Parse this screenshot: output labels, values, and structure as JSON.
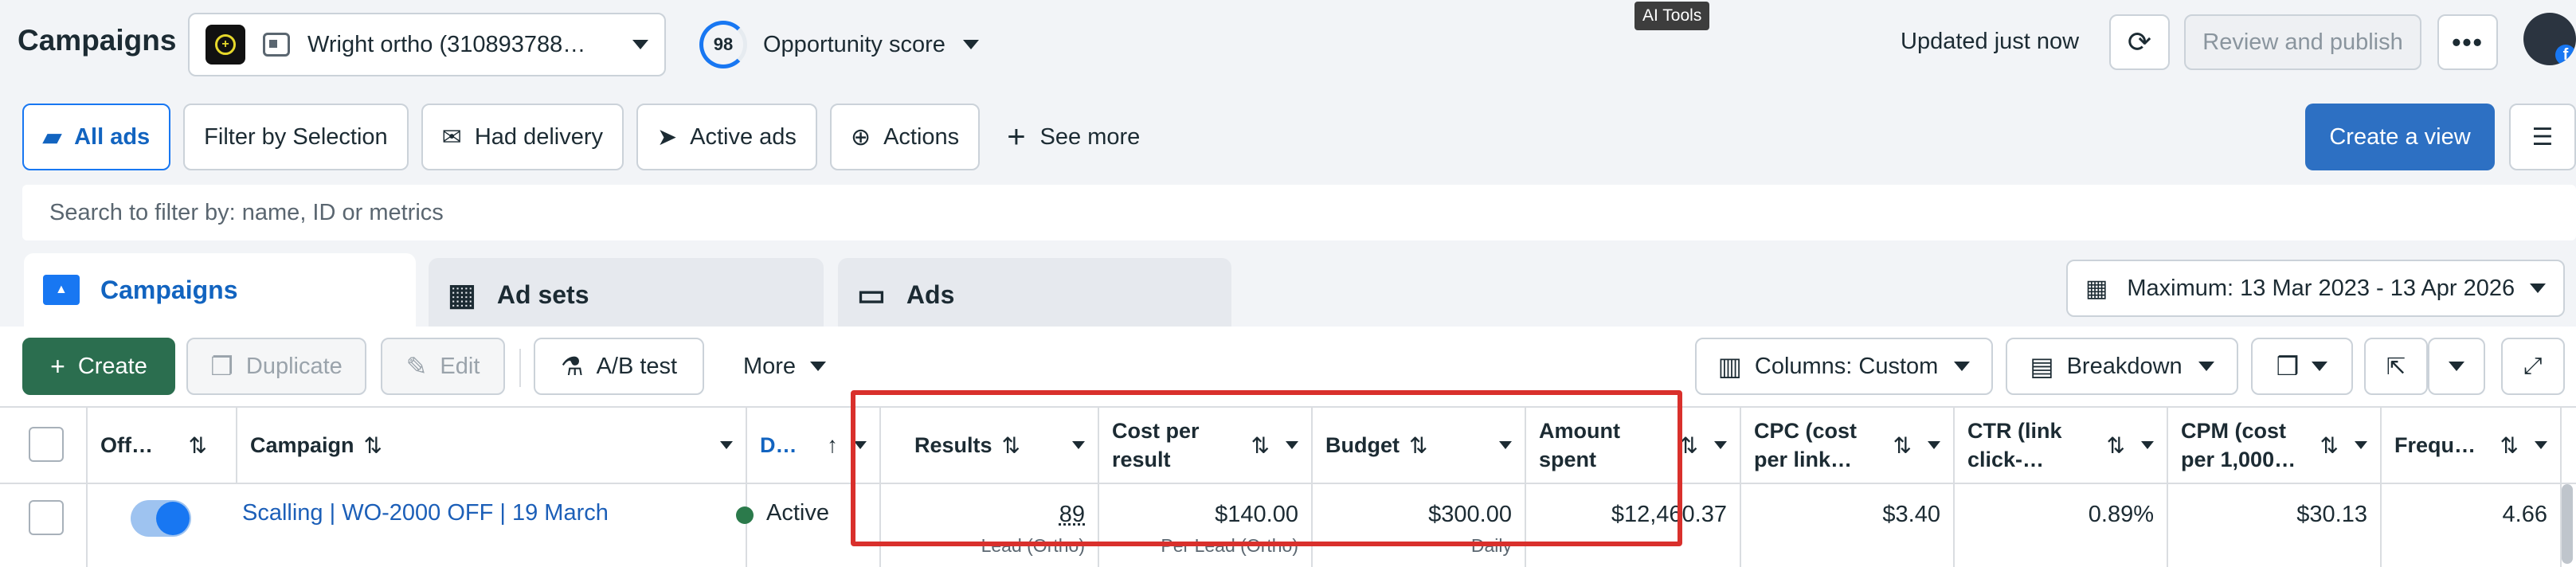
{
  "header": {
    "title": "Campaigns",
    "account_name": "Wright ortho (310893788…",
    "opportunity_score": "98",
    "opportunity_label": "Opportunity score",
    "tooltip": "AI Tools",
    "updated": "Updated just now",
    "review_label": "Review and publish",
    "more_label": "•••"
  },
  "filters": {
    "items": [
      {
        "label": "All ads",
        "icon": "folder-icon"
      },
      {
        "label": "Filter by Selection",
        "icon": ""
      },
      {
        "label": "Had delivery",
        "icon": "envelope-icon"
      },
      {
        "label": "Active ads",
        "icon": "send-icon"
      },
      {
        "label": "Actions",
        "icon": "upload-icon"
      }
    ],
    "see_more": "See more",
    "create_view": "Create a view"
  },
  "search": {
    "placeholder": "Search to filter by: name, ID or metrics"
  },
  "tabs": [
    {
      "label": "Campaigns"
    },
    {
      "label": "Ad sets"
    },
    {
      "label": "Ads"
    }
  ],
  "date_range": "Maximum: 13 Mar 2023 - 13 Apr 2026",
  "toolbar": {
    "create": "Create",
    "duplicate": "Duplicate",
    "edit": "Edit",
    "ab_test": "A/B test",
    "more": "More",
    "columns": "Columns: Custom",
    "breakdown": "Breakdown"
  },
  "table": {
    "headers": {
      "off_on": "Off…",
      "campaign": "Campaign",
      "delivery": "D…",
      "results": "Results",
      "cost_per_result": "Cost per result",
      "budget": "Budget",
      "amount_spent": "Amount spent",
      "cpc": "CPC (cost per link…",
      "ctr": "CTR (link click-…",
      "cpm": "CPM (cost per 1,000…",
      "frequency": "Frequ…"
    },
    "row": {
      "campaign": "Scalling | WO-2000 OFF | 19 March",
      "delivery": "Active",
      "results": "89",
      "results_sub": "Lead (Ortho)",
      "cost_per_result": "$140.00",
      "cost_per_result_sub": "Per Lead (Ortho)",
      "budget": "$300.00",
      "budget_sub": "Daily",
      "amount_spent": "$12,460.37",
      "cpc": "$3.40",
      "ctr": "0.89%",
      "cpm": "$30.13",
      "frequency": "4.66"
    }
  },
  "colors": {
    "primary_blue": "#2d70c3",
    "create_green": "#2b6e4f",
    "highlight_red": "#d9302c",
    "status_green": "#2b7a4b"
  }
}
